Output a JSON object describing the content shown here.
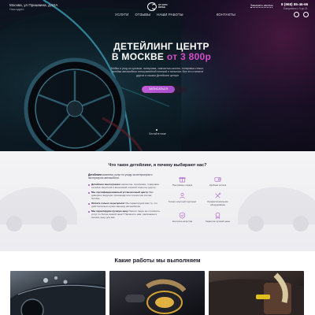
{
  "header": {
    "address": "Москва, ул Пришвина, д.22А",
    "address_sub": "Наш адрес",
    "nav": [
      "УСЛУГИ",
      "ОТЗЫВЫ",
      "НАШИ РАБОТЫ",
      "КОНТАКТЫ"
    ],
    "logo_text": "GT AUTO DETAIL",
    "callback": "Заказать звонок",
    "phone": "8 (968) 85-46-66",
    "hours": "Ежедневно с 9 до 21"
  },
  "hero": {
    "title_line1": "ДЕТЕЙЛИНГ ЦЕНТР",
    "title_line2": "В МОСКВЕ",
    "price": "от 3 800р",
    "description": "Мойка и уход за кузовом, полировка, химчистка салона, тонировка стекол, оклейка автомобиля антигравийной пленкой и винилом. Все это и многое другое в нашем Детейлинг центре",
    "cta": "ЗАПИСАТЬСЯ",
    "scroll": "Листайте ниже"
  },
  "why": {
    "title": "Что такое детейлинг, и почему выбирают нас?",
    "intro_bold": "Детейлинг",
    "intro_rest": " комплекс услуг по уходу за интерьером и экстерьером автомобиля.",
    "reasons": [
      {
        "bold": "Детейлинг многогранен",
        "rest": " химчистка, полировка, тонировка, оклейка защитной и виниловой пленкой и многое другое."
      },
      {
        "bold": "Мы сертифицированный установочный центр",
        "rest": " Нам доверяют ведущие производители пленок как Llumar, SunTek."
      },
      {
        "bold": "Оплата только за результат",
        "rest": " Мы гарантируем вам то, что действительно нужно вашему автомобилю."
      },
      {
        "bold": "Мы гарантируем лучшую цену",
        "rest": " Нашли такую же стоимость услуг по более низкой цене? Напишите нам, расскажем и снизим цену для вас."
      }
    ],
    "features": [
      {
        "icon": "gift-icon",
        "label": "Программы скидок"
      },
      {
        "icon": "wallet-icon",
        "label": "Удобная оплата"
      },
      {
        "icon": "user-icon",
        "label": "Только опытный персонал"
      },
      {
        "icon": "tools-icon",
        "label": "Профессиональное оборудование"
      },
      {
        "icon": "shield-icon",
        "label": "Контроль качества"
      },
      {
        "icon": "badge-icon",
        "label": "Гарантия лучшей цены"
      }
    ]
  },
  "works": {
    "title": "Какие работы мы выполняем"
  },
  "colors": {
    "accent": "#a24ecb",
    "price": "#d44cc8",
    "text_dark": "#1c1c28"
  }
}
